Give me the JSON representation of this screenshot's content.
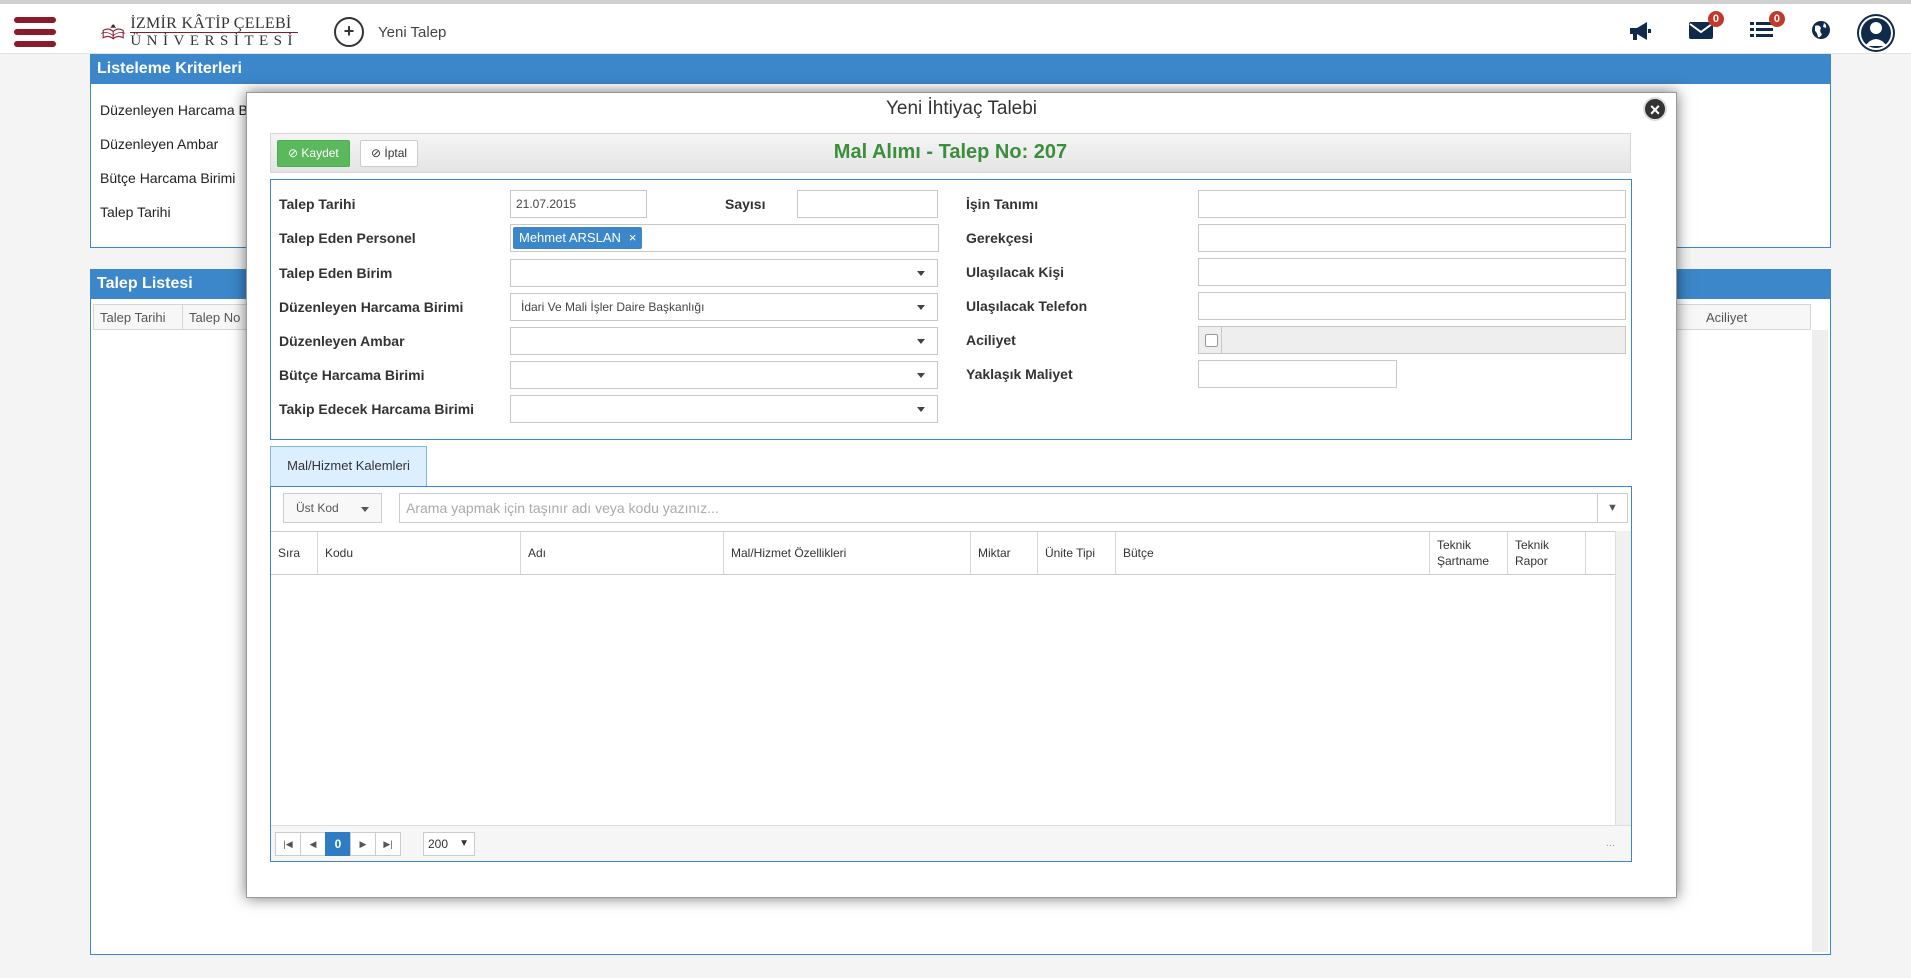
{
  "header": {
    "logo_line1": "İZMİR KÂTİP ÇELEBİ",
    "logo_line2": "ÜNİVERSİTESİ",
    "new_request_label": "Yeni Talep",
    "new_request_symbol": "+",
    "messages_count": "0",
    "tasks_count": "0"
  },
  "criteria_panel": {
    "title": "Listeleme Kriterleri",
    "rows": [
      "Düzenleyen Harcama B",
      "Düzenleyen Ambar",
      "Bütçe Harcama Birimi",
      "Talep Tarihi"
    ]
  },
  "list_panel": {
    "title": "Talep Listesi",
    "columns": [
      "Talep Tarihi",
      "Talep No",
      "Aciliyet"
    ]
  },
  "modal": {
    "title": "Yeni İhtiyaç Talebi",
    "close_symbol": "×",
    "save_label": "Kaydet",
    "cancel_label": "İptal",
    "heading": "Mal Alımı - Talep No: 207",
    "form": {
      "talep_tarihi_label": "Talep Tarihi",
      "talep_tarihi_value": "21.07.2015",
      "sayisi_label": "Sayısı",
      "sayisi_value": "",
      "personel_label": "Talep Eden Personel",
      "personel_tag": "Mehmet ARSLAN",
      "personel_tag_remove": "×",
      "birim_label": "Talep Eden Birim",
      "birim_value": "",
      "harcama_label": "Düzenleyen Harcama Birimi",
      "harcama_value": "İdari Ve Mali İşler Daire Başkanlığı",
      "ambar_label": "Düzenleyen Ambar",
      "ambar_value": "",
      "butce_label": "Bütçe Harcama Birimi",
      "butce_value": "",
      "takip_label": "Takip Edecek Harcama Birimi",
      "takip_value": "",
      "isin_tanimi_label": "İşin Tanımı",
      "gerekcesi_label": "Gerekçesi",
      "ulasilacak_kisi_label": "Ulaşılacak Kişi",
      "ulasilacak_telefon_label": "Ulaşılacak Telefon",
      "aciliyet_label": "Aciliyet",
      "maliyet_label": "Yaklaşık Maliyet"
    },
    "tab_label": "Mal/Hizmet Kalemleri",
    "items": {
      "upper_code_label": "Üst Kod",
      "search_placeholder": "Arama yapmak için taşınır adı veya kodu yazınız...",
      "columns": [
        "Sıra",
        "Kodu",
        "Adı",
        "Mal/Hizmet Özellikleri",
        "Miktar",
        "Ünite Tipi",
        "Bütçe",
        "Teknik Şartname",
        "Teknik Rapor"
      ],
      "current_page": "0",
      "page_size": "200",
      "pager_dots": "..."
    }
  },
  "colors": {
    "brand": "#8b1a2b",
    "panel_blue": "#3b87c9",
    "save_green": "#5cb85c",
    "heading_green": "#3c8d3c"
  }
}
